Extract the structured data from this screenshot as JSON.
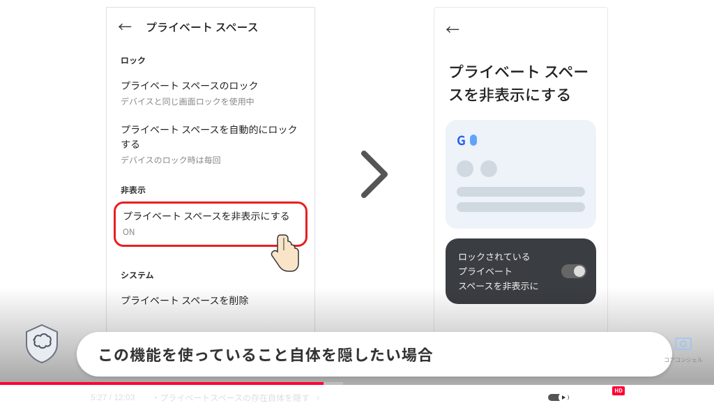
{
  "leftPhone": {
    "headerTitle": "プライベート スペース",
    "sections": {
      "lock": {
        "label": "ロック",
        "item1": {
          "title": "プライベート スペースのロック",
          "sub": "デバイスと同じ画面ロックを使用中"
        },
        "item2": {
          "title": "プライベート スペースを自動的にロックする",
          "sub": "デバイスのロック時は毎回"
        }
      },
      "hide": {
        "label": "非表示",
        "item": {
          "title": "プライベート スペースを非表示にする",
          "sub": "ON"
        }
      },
      "system": {
        "label": "システム",
        "item": {
          "title": "プライベート スペースを削除"
        }
      }
    }
  },
  "rightPhone": {
    "heading": "プライベート スペースを非表示にする",
    "darkCard": {
      "line1": "ロックされている",
      "line2": "プライベート",
      "line3": "スペースを非表示に"
    }
  },
  "caption": "この機能を使っていること自体を隠したい場合",
  "brandText": "コアコンシェル",
  "player": {
    "currentTime": "5:27",
    "duration": "12:03",
    "chapterPrefix": "・",
    "chapterTitle": "プライベートスペースの存在自体を隠す",
    "hdLabel": "HD"
  }
}
